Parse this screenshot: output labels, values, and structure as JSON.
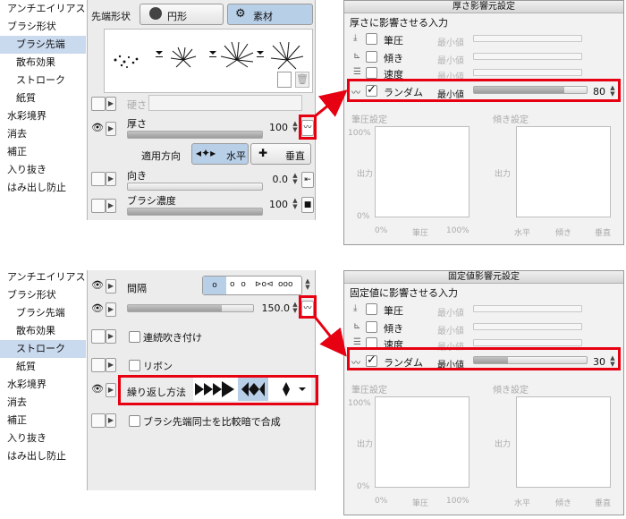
{
  "top": {
    "categories": [
      {
        "label": "アンチエイリアス",
        "level": 0,
        "selected": false
      },
      {
        "label": "ブラシ形状",
        "level": 0,
        "selected": false
      },
      {
        "label": "ブラシ先端",
        "level": 1,
        "selected": true
      },
      {
        "label": "散布効果",
        "level": 1,
        "selected": false
      },
      {
        "label": "ストローク",
        "level": 1,
        "selected": false
      },
      {
        "label": "紙質",
        "level": 1,
        "selected": false
      },
      {
        "label": "水彩境界",
        "level": 0,
        "selected": false
      },
      {
        "label": "消去",
        "level": 0,
        "selected": false
      },
      {
        "label": "補正",
        "level": 0,
        "selected": false
      },
      {
        "label": "入り抜き",
        "level": 0,
        "selected": false
      },
      {
        "label": "はみ出し防止",
        "level": 0,
        "selected": false
      }
    ],
    "tip_shape_label": "先端形状",
    "circle_label": "円形",
    "material_label": "素材",
    "hardness_label": "硬さ",
    "thickness_label": "厚さ",
    "thickness_value": "100",
    "thickness_level": 1.0,
    "direction_apply_label": "適用方向",
    "horizontal_label": "水平",
    "vertical_label": "垂直",
    "orientation_label": "向き",
    "orientation_value": "0.0",
    "orientation_level": 0.0,
    "brush_density_label": "ブラシ濃度",
    "brush_density_value": "100",
    "brush_density_level": 1.0
  },
  "bottom": {
    "categories": [
      {
        "label": "アンチエイリアス",
        "level": 0,
        "selected": false
      },
      {
        "label": "ブラシ形状",
        "level": 0,
        "selected": false
      },
      {
        "label": "ブラシ先端",
        "level": 1,
        "selected": false
      },
      {
        "label": "散布効果",
        "level": 1,
        "selected": false
      },
      {
        "label": "ストローク",
        "level": 1,
        "selected": true
      },
      {
        "label": "紙質",
        "level": 1,
        "selected": false
      },
      {
        "label": "水彩境界",
        "level": 0,
        "selected": false
      },
      {
        "label": "消去",
        "level": 0,
        "selected": false
      },
      {
        "label": "補正",
        "level": 0,
        "selected": false
      },
      {
        "label": "入り抜き",
        "level": 0,
        "selected": false
      },
      {
        "label": "はみ出し防止",
        "level": 0,
        "selected": false
      }
    ],
    "interval_label": "間隔",
    "interval_value": "150.0",
    "interval_level": 0.75,
    "continuous_spray_label": "連続吹き付け",
    "ribbon_label": "リボン",
    "repeat_method_label": "繰り返し方法",
    "compare_tips_label": "ブラシ先端同士を比較暗で合成"
  },
  "dialog1": {
    "title": "厚さ影響元設定",
    "heading": "厚さに影響させる入力",
    "rows": [
      {
        "label": "筆圧",
        "checked": false,
        "min_label": "最小値",
        "active": false
      },
      {
        "label": "傾き",
        "checked": false,
        "min_label": "最小値",
        "active": false
      },
      {
        "label": "速度",
        "checked": false,
        "min_label": "最小値",
        "active": false
      },
      {
        "label": "ランダム",
        "checked": true,
        "min_label": "最小値",
        "active": true,
        "value": "80",
        "level": 0.8
      }
    ],
    "pressure_setting": "筆圧設定",
    "tilt_setting": "傾き設定",
    "out_label": "出力",
    "y_top": "100%",
    "y_bottom": "0%",
    "pressure_axis": [
      "0%",
      "筆圧",
      "100%"
    ],
    "tilt_axis": [
      "水平",
      "傾き",
      "垂直"
    ]
  },
  "dialog2": {
    "title": "固定値影響元設定",
    "heading": "固定値に影響させる入力",
    "rows": [
      {
        "label": "筆圧",
        "checked": false,
        "min_label": "最小値",
        "active": false
      },
      {
        "label": "傾き",
        "checked": false,
        "min_label": "最小値",
        "active": false
      },
      {
        "label": "速度",
        "checked": false,
        "min_label": "最小値",
        "active": false
      },
      {
        "label": "ランダム",
        "checked": true,
        "min_label": "最小値",
        "active": true,
        "value": "30",
        "level": 0.3
      }
    ],
    "pressure_setting": "筆圧設定",
    "tilt_setting": "傾き設定",
    "out_label": "出力",
    "y_top": "100%",
    "y_bottom": "0%",
    "pressure_axis": [
      "0%",
      "筆圧",
      "100%"
    ],
    "tilt_axis": [
      "水平",
      "傾き",
      "垂直"
    ]
  },
  "colors": {
    "highlight": "#e60012",
    "selected": "#c9d9ee",
    "active_toggle": "#b8cfe8"
  }
}
